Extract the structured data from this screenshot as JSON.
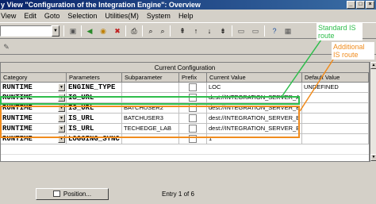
{
  "window": {
    "title": "y View \"Configuration of the Integration Engine\": Overview",
    "btn_min": "_",
    "btn_max": "□",
    "btn_close": "×"
  },
  "menu": [
    "View",
    "Edit",
    "Goto",
    "Selection",
    "Utilities(M)",
    "System",
    "Help"
  ],
  "table": {
    "group_header": "Current Configuration",
    "columns": [
      "Category",
      "Parameters",
      "Subparameter",
      "Prefix",
      "Current Value",
      "Default Value"
    ],
    "rows": [
      {
        "category": "RUNTIME",
        "parameter": "ENGINE_TYPE",
        "subparameter": "",
        "current_value": "LOC",
        "default_value": "UNDEFINED"
      },
      {
        "category": "RUNTIME",
        "parameter": "IS_URL",
        "subparameter": "",
        "current_value": "dest://INTEGRATION_SERVER_A",
        "default_value": ""
      },
      {
        "category": "RUNTIME",
        "parameter": "IS_URL",
        "subparameter": "BATCHUSER2",
        "current_value": "dest://INTEGRATION_SERVER_B",
        "default_value": ""
      },
      {
        "category": "RUNTIME",
        "parameter": "IS_URL",
        "subparameter": "BATCHUSER3",
        "current_value": "dest://INTEGRATION_SERVER_B",
        "default_value": ""
      },
      {
        "category": "RUNTIME",
        "parameter": "IS_URL",
        "subparameter": "TECHEDGE_LAB",
        "current_value": "dest://INTEGRATION_SERVER_B",
        "default_value": ""
      },
      {
        "category": "RUNTIME",
        "parameter": "LOGGING_SYNC",
        "subparameter": "",
        "current_value": "1",
        "default_value": ""
      }
    ]
  },
  "annotations": {
    "standard": "Standard IS route",
    "additional": "Additional IS route",
    "standard_color": "#2ebd4b",
    "additional_color": "#f08c1e"
  },
  "footer": {
    "position_button": "Position...",
    "entry_info": "Entry 1 of 6"
  }
}
